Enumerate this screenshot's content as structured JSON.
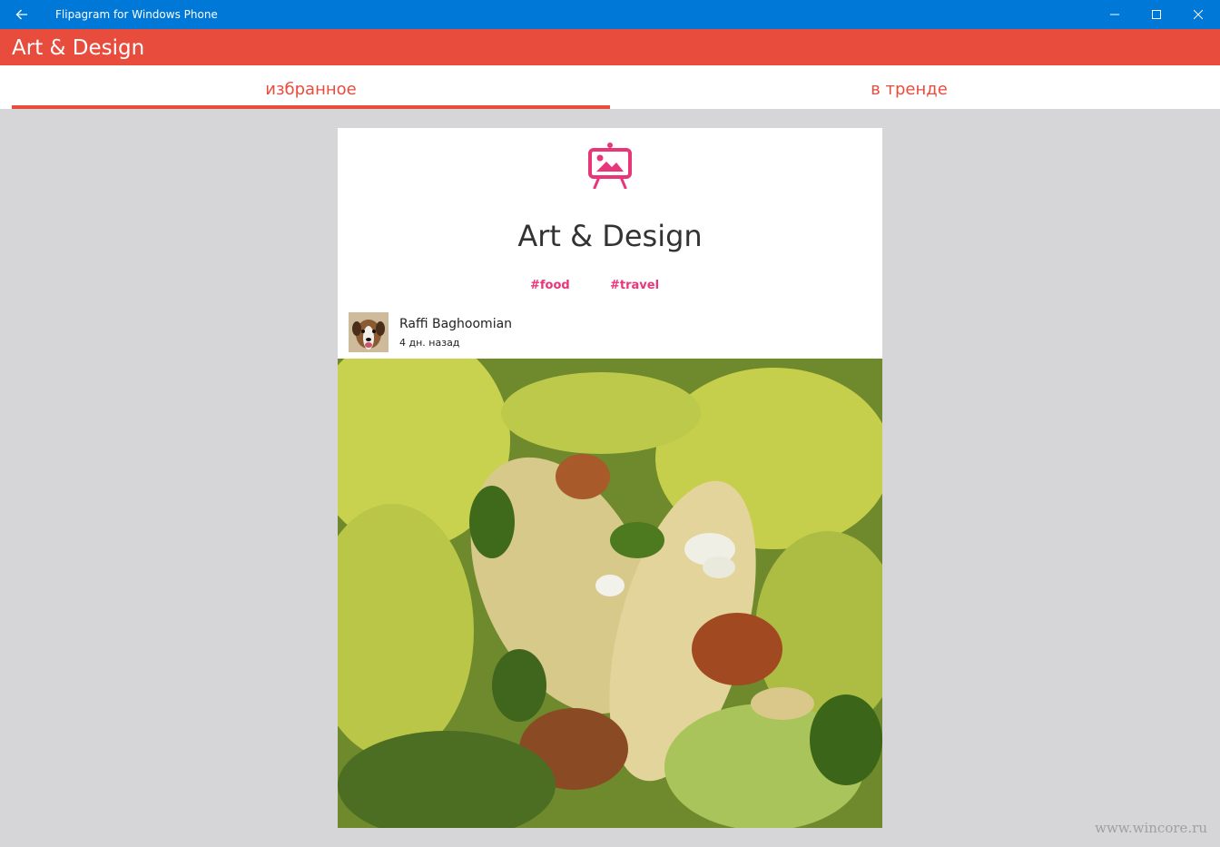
{
  "window": {
    "title": "Flipagram for Windows Phone",
    "back_icon": "back-arrow-icon",
    "controls": [
      "minimize-icon",
      "maximize-icon",
      "close-icon"
    ],
    "accent_color": "#0078d7"
  },
  "appbar": {
    "title": "Art & Design",
    "color": "#e84c3d"
  },
  "tabs": [
    {
      "label": "избранное",
      "selected": true
    },
    {
      "label": "в тренде",
      "selected": false
    }
  ],
  "card": {
    "icon": "easel-picture-icon",
    "title": "Art & Design",
    "tags": [
      "#food",
      "#travel"
    ],
    "tag_color": "#e8367a",
    "post": {
      "author": "Raffi Baghoomian",
      "timestamp": "4 дн. назад",
      "avatar": "dog-avatar",
      "image": "tacos-photo"
    }
  },
  "watermark": "www.wincore.ru"
}
